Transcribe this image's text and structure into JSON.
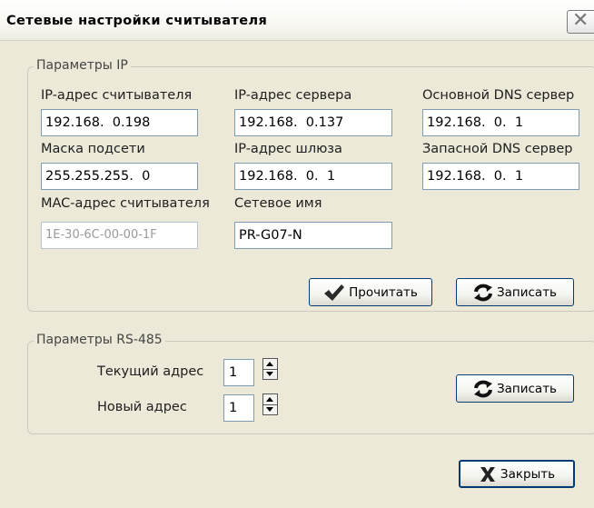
{
  "window": {
    "title": "Сетевые настройки считывателя",
    "close_glyph": "✕"
  },
  "ip_group": {
    "legend": "Параметры IP",
    "reader_ip": {
      "label": "IP-адрес считывателя",
      "value": "192.168.  0.198"
    },
    "server_ip": {
      "label": "IP-адрес сервера",
      "value": "192.168.  0.137"
    },
    "primary_dns": {
      "label": "Основной DNS сервер",
      "value": "192.168.  0.  1"
    },
    "subnet_mask": {
      "label": "Маска подсети",
      "value": "255.255.255.  0"
    },
    "gateway_ip": {
      "label": "IP-адрес шлюза",
      "value": "192.168.  0.  1"
    },
    "secondary_dns": {
      "label": "Запасной DNS сервер",
      "value": "192.168.  0.  1"
    },
    "mac": {
      "label": "MAC-адрес считывателя",
      "value": "1E-30-6C-00-00-1F"
    },
    "hostname": {
      "label": "Сетевое имя",
      "value": "PR-G07-N"
    },
    "read_button": {
      "label": "Прочитать",
      "icon": "checkmark-icon",
      "icon_color": "#2a2a2a"
    },
    "write_button": {
      "label": "Записать",
      "icon": "refresh-icon"
    }
  },
  "rs485_group": {
    "legend": "Параметры RS-485",
    "current_address": {
      "label": "Текущий адрес",
      "value": "1"
    },
    "new_address": {
      "label": "Новый адрес",
      "value": "1"
    },
    "write_button": {
      "label": "Записать",
      "icon": "refresh-icon"
    }
  },
  "footer": {
    "close_button": {
      "label": "Закрыть",
      "icon": "cross-icon"
    }
  },
  "colors": {
    "dialog_bg": "#ece9d8",
    "input_border": "#7f9db9",
    "button_border": "#003c74",
    "group_border": "#cdcabd"
  }
}
